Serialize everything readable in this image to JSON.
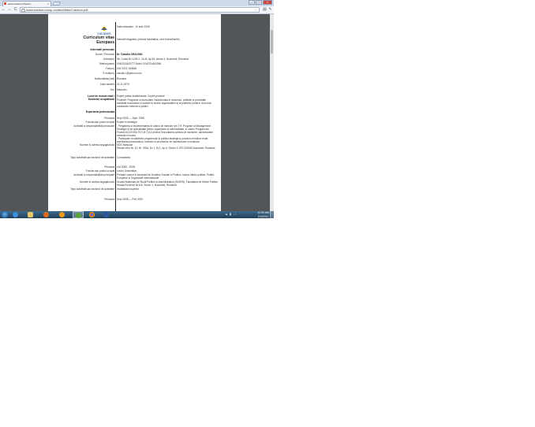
{
  "browser": {
    "tab_title": "www.ezelser.ro/Sorin/...",
    "tab_close": "×",
    "window_buttons": [
      "–",
      "□",
      "×"
    ],
    "address": "www.ezelser.ro/wp-content/files/Cracium.pdf",
    "back": "←",
    "forward": "→",
    "reload": "C",
    "star": "☆",
    "wrench": "🔧"
  },
  "cv": {
    "date_line": "Data redactarii : 10 iulie 2008",
    "logo_text": "europass",
    "title_line1": "Curriculum vitae",
    "title_line2": "Europass",
    "header_right": "Inserati fotografia. (rubrica facultativa, vezi instructiunile)",
    "personal_section": "Informatii personale",
    "rows": [
      {
        "label": "Nume / Prenume",
        "value": "Dr. Claudiu CRACIUN"
      },
      {
        "label": "Adresa(e)",
        "value": "Str. Costa Nr.14 Bl.3 . Sc.B. Ap 63, sector 4, Bucuresti, Romania"
      },
      {
        "label": "Telefon(oane)",
        "value": "0040215343777                  Mobil:    0040724611956"
      },
      {
        "label": "Fax(uri)",
        "value": "004 0213 160688"
      },
      {
        "label": "E-mail(uri)",
        "value": "claudiu.c@yahoo.com"
      },
      {
        "label": "Nationalitate(-tati)",
        "value": "Romana"
      },
      {
        "label": "Data nasterii",
        "value": "22.11.1976"
      },
      {
        "label": "Sex",
        "value": "Masculin"
      }
    ],
    "job_label_1": "Locul de munca vizat /",
    "job_label_2": "Domeniul ocupational",
    "job_value_1": "Expert politici institutionale. Expert proiecte",
    "job_value_2": "Proiecte: Programe si dezvoltare institutionala in domeniul, politicile si prioritatile activitatii economice si sociale la nivelul organizatiilor si al politicilor publice. Acord de colaborare externa si politici",
    "experience_section": "Experienta profesionala",
    "exp1": {
      "period_label": "Perioada",
      "period": "Sept 2005 — Sept. 2008",
      "role_label": "Functia sau postul ocupat",
      "role": "Expert in strategie",
      "duties_label": "Activitati si responsabilitati principale",
      "duties": "- Pregatirea si implementarea in cadrul de instruire din T.H. Program al Management Strategic si de specialitate pentru organizare si administratie, in cadrul Programului Proiect ACCESSA TE/ UE 2112 privind Dezvoltarea publica de ministere, administratie centrala si locala",
      "duties2": "- Participare la stabilirea programului si politica strategica, practica metodice reale, clarificarea personalului, metodei si proceselor de monitorizare si evaluare",
      "employer_label": "Numele si adresa angajatorului",
      "employer": "SDG Bahcuse",
      "employer_addr": "Strada Vrbo Nr. 12, Bl. V92a, Sc 1, Et 1, Ap 6, Sector 3, RO-031080 Bucuresti, Romania",
      "sector_label": "Tipul activitatii sau sectorul de activitate",
      "sector": "Consultanta"
    },
    "exp2": {
      "period_label": "Perioada",
      "period": "Oct 2005 - 2008",
      "role_label": "Functia sau postul ocupat",
      "role": "Lector Universitar",
      "duties_label": "Activitati si responsabilitati principale",
      "duties": "Predare cursuri si seminarii de Doctrine Sociale si Politice, Istoria Ideilor politice, Politici Europene si Organizatii Internationale",
      "employer_label": "Numele si adresa angajatorului",
      "employer": "Scoala Nationala de Studii Politice si Administrative (SNSPA), Facultatea de Stiinte Politice",
      "employer_addr": "Strada Povernei Nr.6-8, Sector 1, Bucuresti, Romania",
      "sector_label": "Tipul activitatii sau sectorul de activitate",
      "sector": "Invatamant superior"
    },
    "exp3": {
      "period_label": "Perioada",
      "period": "Sept 2008 — Feb 2009"
    }
  },
  "taskbar": {
    "time": "12:09 AM",
    "date": "2/4/2012",
    "apps": [
      "internet-explorer",
      "windows-explorer",
      "firefox",
      "media-player",
      "utorrent",
      "chrome",
      "word"
    ],
    "active_app": "utorrent"
  }
}
